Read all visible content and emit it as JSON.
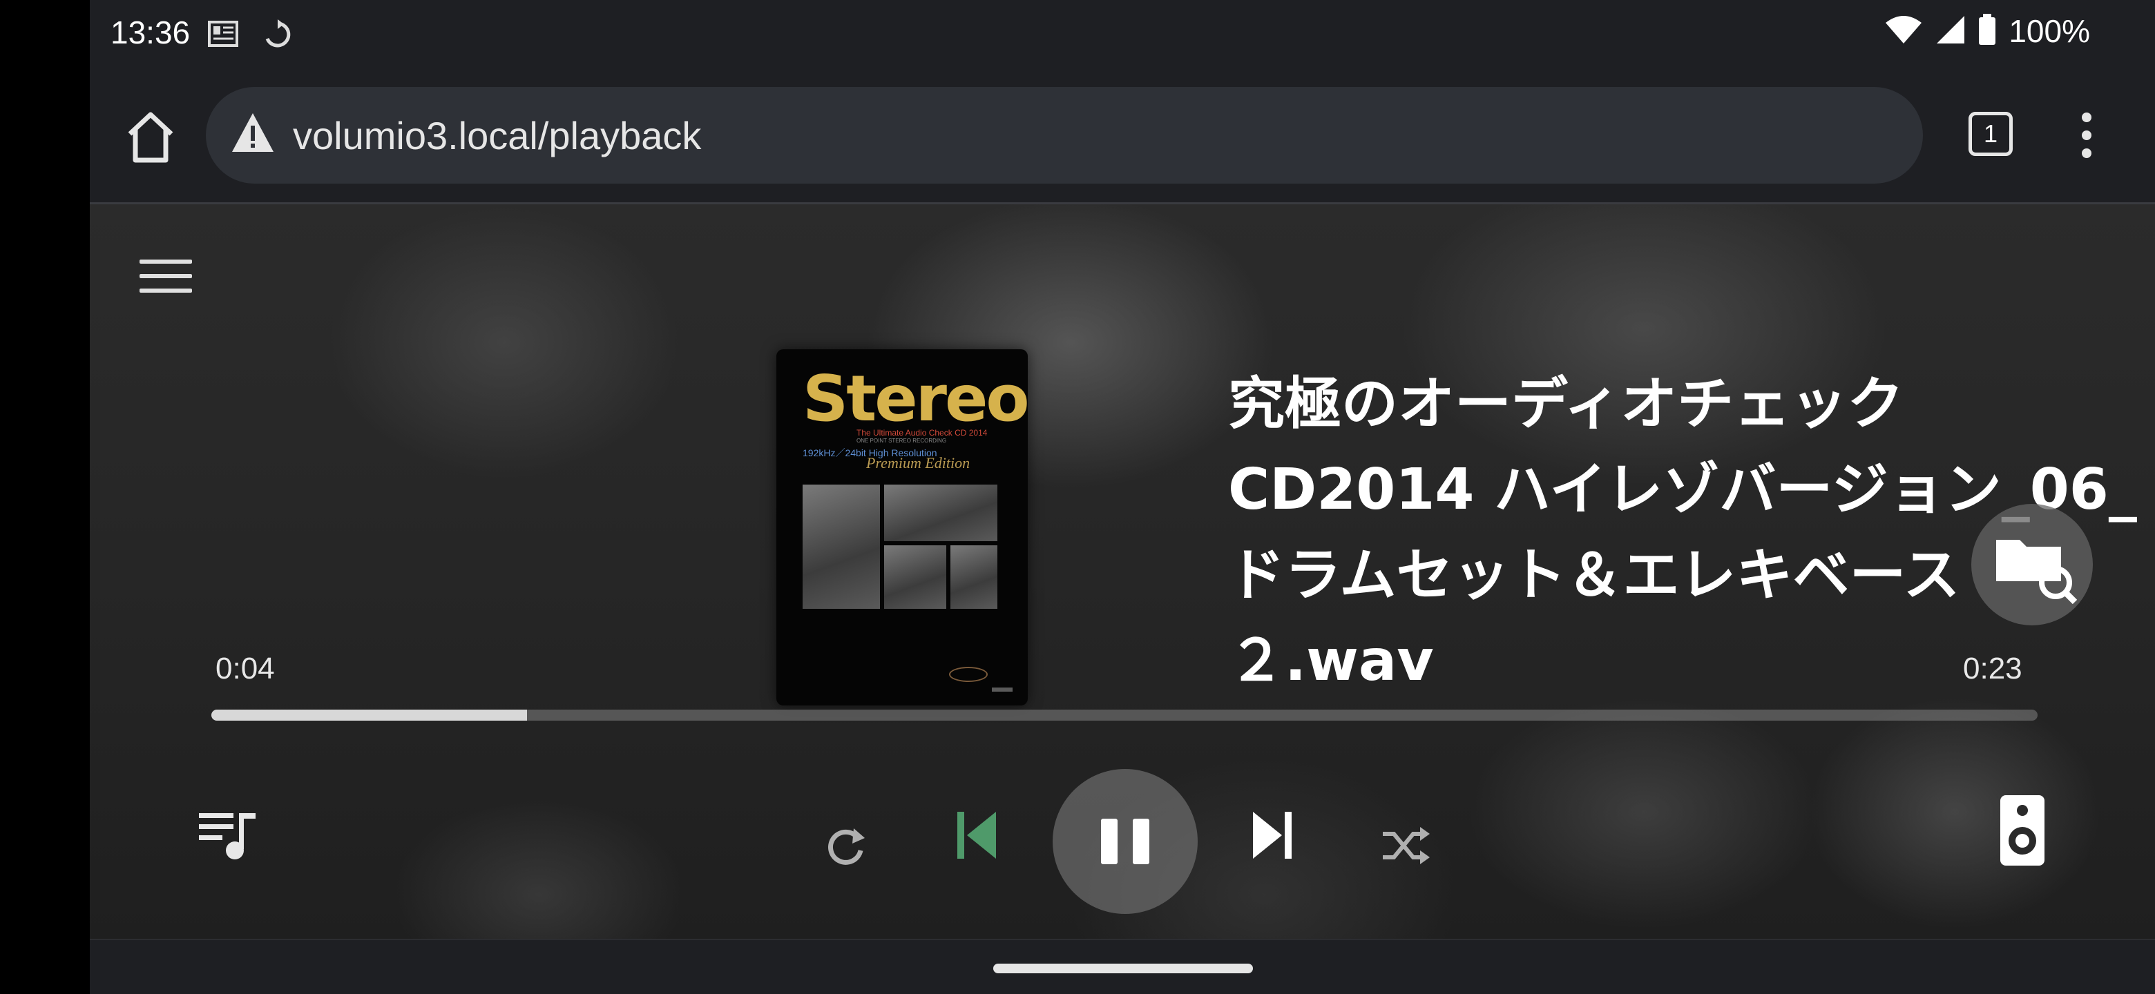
{
  "status_bar": {
    "time": "13:36",
    "battery_text": "100%",
    "icons": [
      "notification-news-icon",
      "sync-icon",
      "wifi-icon",
      "signal-icon",
      "battery-icon"
    ]
  },
  "browser": {
    "url": "volumio3.local/playback",
    "tab_count": "1",
    "icons": [
      "home-icon",
      "warning-icon",
      "tabs-icon",
      "more-vert-icon"
    ]
  },
  "player": {
    "track_title": "究極のオーディオチェックCD2014 ハイレゾバージョン_06_ドラムセット＆エレキベース２.wav",
    "elapsed": "0:04",
    "duration": "0:23",
    "progress_fraction": 0.173,
    "album_art": {
      "logo_text": "Stereo",
      "subtitle": "The Ultimate Audio Check CD 2014",
      "subtitle2": "ONE POINT STEREO RECORDING",
      "hires_text": "192kHz／24bit High Resolution",
      "edition_text": "Premium Edition"
    },
    "controls": {
      "queue": "queue-music-icon",
      "repeat": "repeat-icon",
      "previous": "skip-previous-icon",
      "play_pause": "pause-icon",
      "next": "skip-next-icon",
      "shuffle": "shuffle-icon",
      "speaker": "speaker-icon",
      "browse": "folder-search-icon"
    },
    "colors": {
      "prev_active": "#4f9a6a",
      "icon_default": "#e8e8e8",
      "icon_muted": "#b0b0b0"
    }
  }
}
